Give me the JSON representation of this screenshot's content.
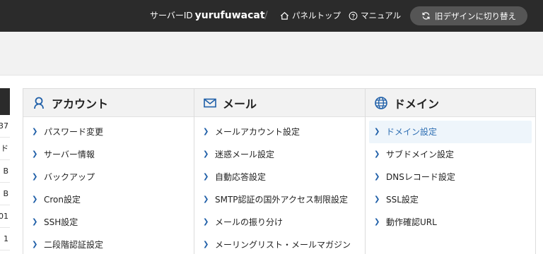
{
  "header": {
    "server_label": "サーバーID",
    "server_id": "yurufuwacat",
    "separator": "/",
    "panel_top": "パネルトップ",
    "manual": "マニュアル",
    "switch_design": "旧デザインに切り替え"
  },
  "sidebar_partial": [
    "37",
    "ド",
    "B",
    "B",
    "01",
    "1"
  ],
  "panels": [
    {
      "title": "アカウント",
      "icon": "user-icon",
      "items": [
        {
          "label": "パスワード変更"
        },
        {
          "label": "サーバー情報"
        },
        {
          "label": "バックアップ"
        },
        {
          "label": "Cron設定"
        },
        {
          "label": "SSH設定"
        },
        {
          "label": "二段階認証設定"
        }
      ]
    },
    {
      "title": "メール",
      "icon": "mail-icon",
      "items": [
        {
          "label": "メールアカウント設定"
        },
        {
          "label": "迷惑メール設定"
        },
        {
          "label": "自動応答設定"
        },
        {
          "label": "SMTP認証の国外アクセス制限設定"
        },
        {
          "label": "メールの振り分け"
        },
        {
          "label": "メーリングリスト・メールマガジン"
        }
      ]
    },
    {
      "title": "ドメイン",
      "icon": "globe-icon",
      "items": [
        {
          "label": "ドメイン設定"
        },
        {
          "label": "サブドメイン設定"
        },
        {
          "label": "DNSレコード設定"
        },
        {
          "label": "SSL設定"
        },
        {
          "label": "動作確認URL"
        }
      ]
    }
  ],
  "colors": {
    "topbar": "#2b2b2b",
    "accent": "#1f5fa8",
    "active_bg": "#eef5fb"
  }
}
